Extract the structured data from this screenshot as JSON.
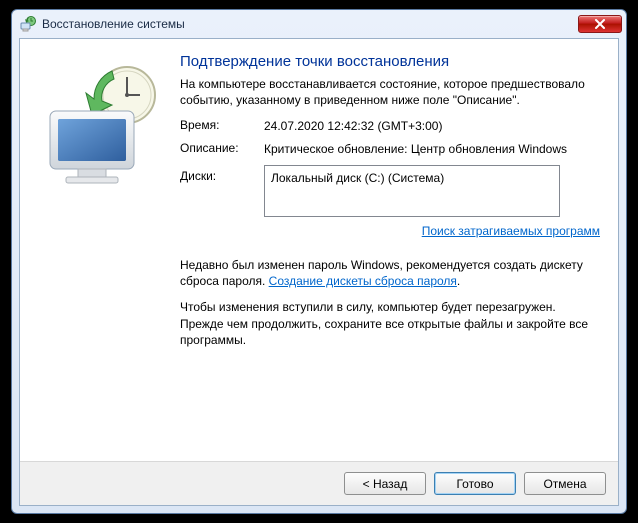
{
  "window": {
    "title": "Восстановление системы"
  },
  "page": {
    "heading": "Подтверждение точки восстановления",
    "intro": "На компьютере восстанавливается состояние, которое предшествовало событию, указанному в приведенном ниже поле \"Описание\".",
    "fields": {
      "time_label": "Время:",
      "time_value": "24.07.2020 12:42:32 (GMT+3:00)",
      "desc_label": "Описание:",
      "desc_value": "Критическое обновление: Центр обновления Windows",
      "disks_label": "Диски:",
      "disks_value": "Локальный диск (C:) (Система)"
    },
    "scan_link": "Поиск затрагиваемых программ",
    "note1_before": "Недавно был изменен пароль Windows, рекомендуется создать дискету сброса пароля. ",
    "note1_link": "Создание дискеты сброса пароля",
    "note1_after": ".",
    "note2": "Чтобы изменения вступили в силу, компьютер будет перезагружен. Прежде чем продолжить, сохраните все открытые файлы и закройте все программы."
  },
  "buttons": {
    "back": "< Назад",
    "finish": "Готово",
    "cancel": "Отмена"
  }
}
